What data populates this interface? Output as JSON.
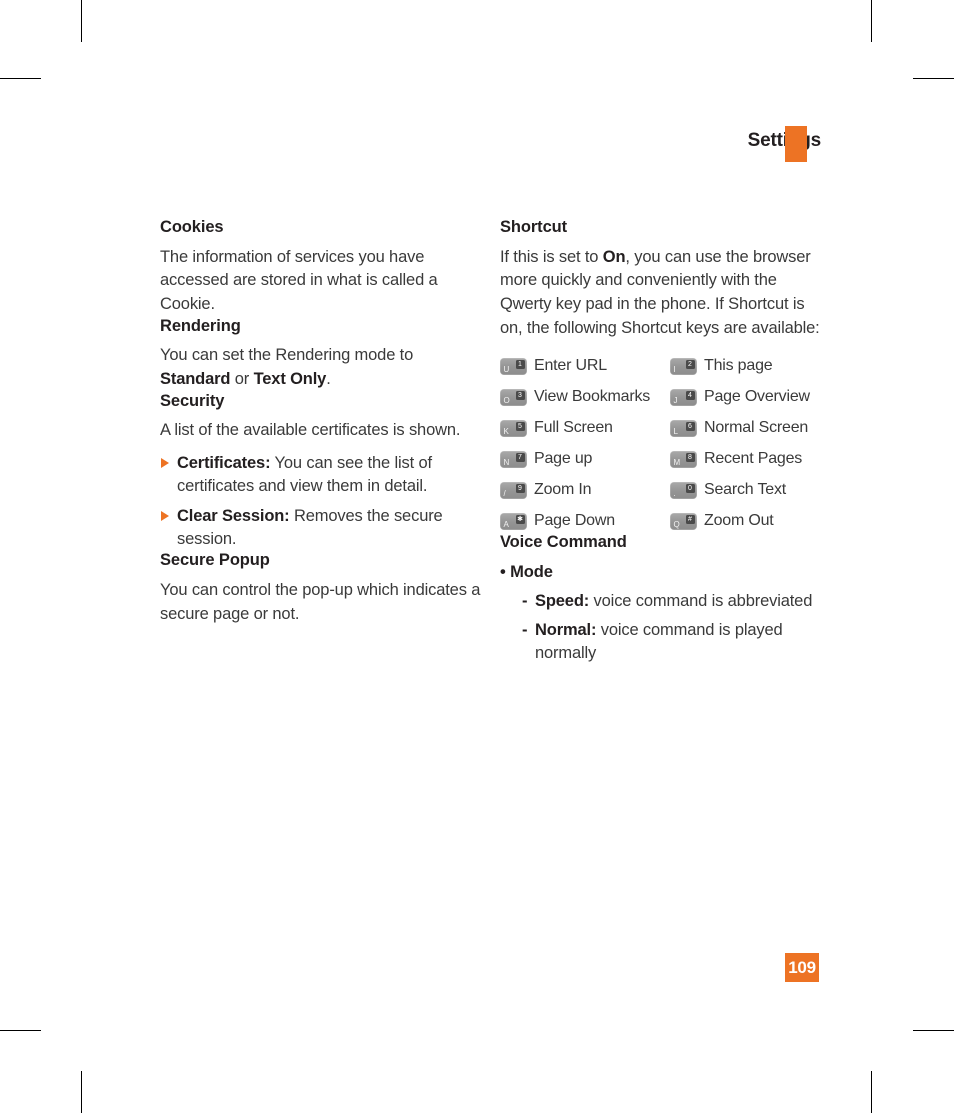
{
  "header": {
    "title": "Settings",
    "accent_color": "#ED7324"
  },
  "folio": {
    "page_number": "109",
    "background": "#ED7324",
    "text_color": "#FFFFFF"
  },
  "left_column": {
    "sections": [
      {
        "heading": "Cookies",
        "body": "The information of services you have accessed are stored in what is called a Cookie."
      },
      {
        "heading": "Rendering",
        "body_parts": [
          {
            "text": "You can set the Rendering mode to ",
            "bold": false
          },
          {
            "text": "Standard",
            "bold": true
          },
          {
            "text": " or ",
            "bold": false
          },
          {
            "text": "Text Only",
            "bold": true
          },
          {
            "text": ".",
            "bold": false
          }
        ]
      },
      {
        "heading": "Security",
        "body": "A list of the available certificates is shown.",
        "bullets": [
          {
            "term": "Certificates:",
            "text": " You can see the list of certificates and view them in detail."
          },
          {
            "term": "Clear Session:",
            "text": " Removes the secure session."
          }
        ]
      },
      {
        "heading": "Secure Popup",
        "body": "You can control the pop-up which indicates a secure page or not."
      }
    ]
  },
  "right_column": {
    "shortcut": {
      "heading": "Shortcut",
      "body_parts": [
        {
          "text": "If this is set to ",
          "bold": false
        },
        {
          "text": "On",
          "bold": true
        },
        {
          "text": ", you can use the browser more quickly and conveniently with the Qwerty key pad in the phone. If Shortcut is on, the following Shortcut keys are available:",
          "bold": false
        }
      ],
      "keys": [
        {
          "letter": "U",
          "badge": "1",
          "label": "Enter URL"
        },
        {
          "letter": "I",
          "badge": "2",
          "label": "This page"
        },
        {
          "letter": "O",
          "badge": "3",
          "label": "View Bookmarks"
        },
        {
          "letter": "J",
          "badge": "4",
          "label": "Page Overview"
        },
        {
          "letter": "K",
          "badge": "5",
          "label": "Full Screen"
        },
        {
          "letter": "L",
          "badge": "6",
          "label": "Normal Screen"
        },
        {
          "letter": "N",
          "badge": "7",
          "label": "Page up"
        },
        {
          "letter": "M",
          "badge": "8",
          "label": "Recent Pages"
        },
        {
          "letter": "/",
          "badge": "9",
          "label": "Zoom In"
        },
        {
          "letter": ".",
          "badge": "0",
          "label": "Search Text"
        },
        {
          "letter": "A",
          "badge": "✱",
          "label": "Page Down"
        },
        {
          "letter": "Q",
          "badge": "#",
          "label": "Zoom Out"
        }
      ]
    },
    "voice_command": {
      "heading": "Voice Command",
      "mode_label": "• Mode",
      "modes": [
        {
          "dash": "-",
          "term": "Speed:",
          "text": " voice command is abbreviated"
        },
        {
          "dash": "-",
          "term": "Normal:",
          "text": " voice command is played normally"
        }
      ]
    }
  }
}
